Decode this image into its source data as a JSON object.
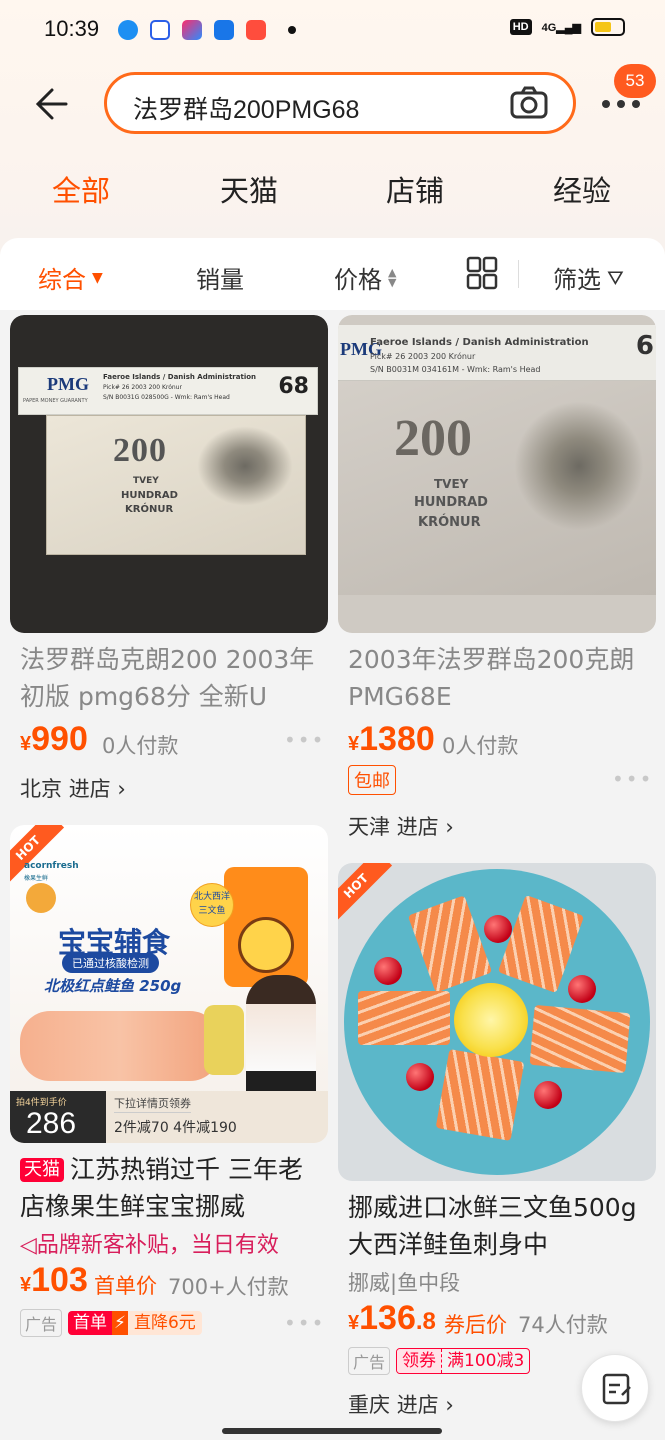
{
  "status": {
    "time": "10:39",
    "hd": "HD",
    "net": "4G"
  },
  "search": {
    "query": "法罗群岛200PMG68",
    "badge": "53"
  },
  "tabs": [
    "全部",
    "天猫",
    "店铺",
    "经验"
  ],
  "sorts": {
    "comprehensive": "综合",
    "sales": "销量",
    "price": "价格",
    "filter": "筛选"
  },
  "colors": {
    "accent": "#ff5000",
    "tmall_red": "#ff0036"
  },
  "products": [
    {
      "title": "法罗群岛克朗200 2003年 初版 pmg68分 全新U",
      "price_symbol": "¥",
      "price": "990",
      "buyers": "0人付款",
      "shop": "北京",
      "enter": "进店",
      "note_label": "Faeroe Islands / Danish Administration",
      "note_pick": "Pick# 26  2003  200 Krónur",
      "note_sn": "S/N B0031G 028500G - Wmk: Ram's Head",
      "grade": "68",
      "pmg": "PMG",
      "pmg_sub": "PAPER MONEY GUARANTY",
      "note_value": "200",
      "note_words": [
        "TVEY",
        "HUNDRAD",
        "KRÓNUR"
      ]
    },
    {
      "title": "2003年法罗群岛200克朗PMG68E",
      "price_symbol": "¥",
      "price": "1380",
      "buyers": "0人付款",
      "tag": "包邮",
      "shop": "天津",
      "enter": "进店",
      "note_label": "Faeroe Islands / Danish Administration",
      "note_pick": "Pick# 26  2003  200 Krónur",
      "note_sn": "S/N B0031M 034161M - Wmk: Ram's Head",
      "grade": "6",
      "pmg": "PMG",
      "note_value": "200",
      "note_words": [
        "TVEY",
        "HUNDRAD",
        "KRÓNUR"
      ]
    },
    {
      "tmall": "天猫",
      "title": "江苏热销过千 三年老店橡果生鲜宝宝挪威",
      "promo": "品牌新客补贴，当日有效",
      "price_symbol": "¥",
      "price": "103",
      "price_label": "首单价",
      "buyers": "700+人付款",
      "ad": "广告",
      "first_order": "首单",
      "discount": "直降6元",
      "hot": "HOT",
      "brand": "acornfresh",
      "brand_cn": "橡果生鲜",
      "headline": "宝宝辅食",
      "checked": "已通过核酸检测",
      "fish_line": "北极红点鲑鱼 250g",
      "region_tag": "北大西洋三文鱼",
      "pack_label": "到手价",
      "pack_prefix": "拍4件到手价",
      "pack_price": "286",
      "pull_text": "下拉详情页领券",
      "bundle": "2件减70  4件减190"
    },
    {
      "title": "挪威进口冰鲜三文鱼500g大西洋鲑鱼刺身中",
      "subtitle": "挪威|鱼中段",
      "price_symbol": "¥",
      "price_int": "136",
      "price_dec": ".8",
      "price_label": "券后价",
      "buyers": "74人付款",
      "ad": "广告",
      "coupon": "领券",
      "coupon_value": "满100减3",
      "shop": "重庆",
      "enter": "进店",
      "hot": "HOT"
    }
  ]
}
